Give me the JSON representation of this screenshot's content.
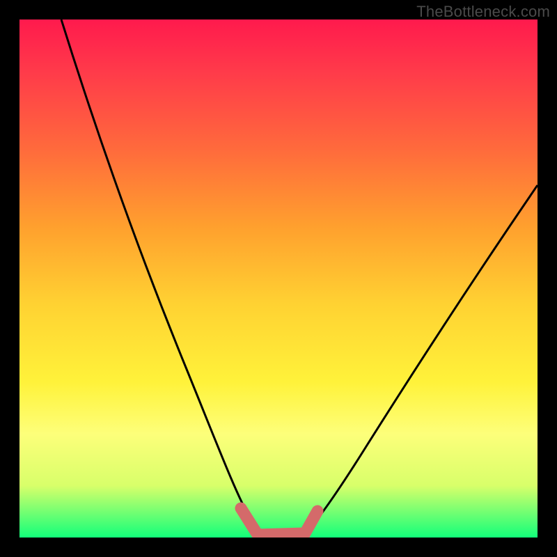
{
  "watermark": "TheBottleneck.com",
  "colors": {
    "background": "#000000",
    "curve_stroke": "#000000",
    "marker_fill": "#d46a6a",
    "gradient_stops": [
      "#ff1a4d",
      "#ff3a4a",
      "#ff6a3c",
      "#ffa02e",
      "#ffd232",
      "#fff23a",
      "#fdff7a",
      "#d8ff6a",
      "#12ff7a"
    ]
  },
  "chart_data": {
    "type": "line",
    "title": "",
    "xlabel": "",
    "ylabel": "",
    "xlim": [
      0,
      100
    ],
    "ylim": [
      0,
      100
    ],
    "series": [
      {
        "name": "left-curve",
        "x": [
          8,
          12,
          16,
          20,
          24,
          28,
          32,
          35,
          38,
          40,
          42,
          44,
          45
        ],
        "y": [
          100,
          88,
          76,
          64,
          52,
          40,
          28,
          18,
          10,
          6,
          3,
          1,
          0
        ]
      },
      {
        "name": "right-curve",
        "x": [
          52,
          55,
          60,
          65,
          70,
          75,
          80,
          85,
          90,
          95,
          100
        ],
        "y": [
          0,
          3,
          8,
          14,
          21,
          29,
          37,
          45,
          53,
          60,
          68
        ]
      },
      {
        "name": "valley-marker",
        "x": [
          41,
          43,
          45,
          48,
          51,
          53,
          54
        ],
        "y": [
          4,
          1,
          0,
          0,
          0,
          2,
          5
        ]
      }
    ]
  }
}
